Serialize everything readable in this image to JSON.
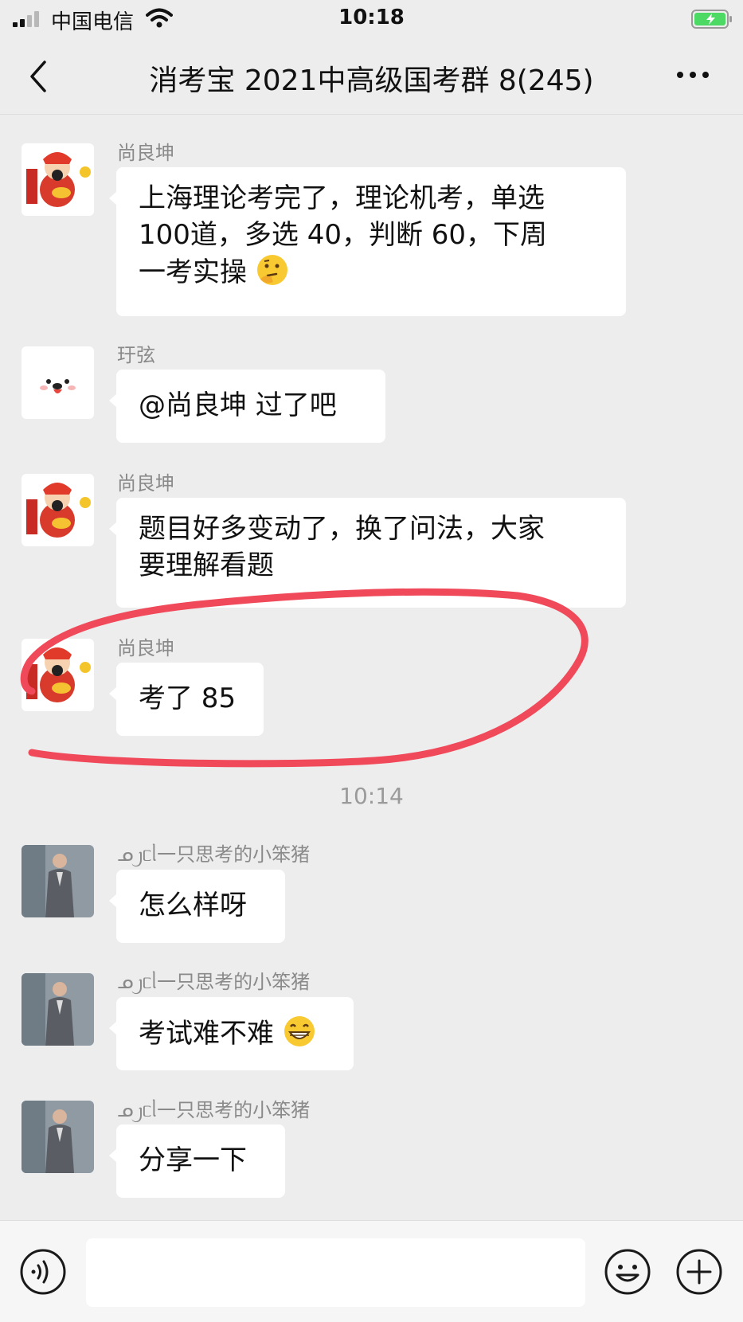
{
  "status": {
    "carrier": "中国电信",
    "time": "10:18"
  },
  "header": {
    "title": "消考宝 2021中高级国考群 8(245)"
  },
  "messages": [
    {
      "sender": "尚良坤",
      "avatar": "god-of-wealth",
      "text": "上海理论考完了，理论机考，单选100道，多选 40，判断 60，下周一考实操",
      "lines": [
        "上海理论考完了，理论机考，单选",
        "100道，多选 40，判断 60，下周",
        "一考实操"
      ],
      "emoji": "thinking-face-emoji"
    },
    {
      "sender": "玗弦",
      "avatar": "bear-face",
      "text": "@尚良坤 过了吧"
    },
    {
      "sender": "尚良坤",
      "avatar": "god-of-wealth",
      "lines": [
        "题目好多变动了，换了问法，大家",
        "要理解看题"
      ]
    },
    {
      "sender": "尚良坤",
      "avatar": "god-of-wealth",
      "text": "考了 85"
    },
    {
      "sender": "ᓄ᧒ᥴᥣ一只思考的小笨猪",
      "avatar": "man-in-suit",
      "text": "怎么样呀"
    },
    {
      "sender": "ᓄ᧒ᥴᥣ一只思考的小笨猪",
      "avatar": "man-in-suit",
      "text": "考试难不难",
      "emoji": "grinning-face-emoji"
    },
    {
      "sender": "ᓄ᧒ᥴᥣ一只思考的小笨猪",
      "avatar": "man-in-suit",
      "text": "分享一下"
    }
  ],
  "time_separator": "10:14",
  "annotation": {
    "shape": "red-hand-drawn-circle",
    "color": "#f0495a"
  },
  "colors": {
    "background": "#ededed",
    "bubble": "#ffffff",
    "sender_name": "#8a8a8a",
    "battery_charging": "#4cd964"
  },
  "icons": [
    "back-icon",
    "more-icon",
    "voice-icon",
    "emoji-icon",
    "plus-icon"
  ]
}
